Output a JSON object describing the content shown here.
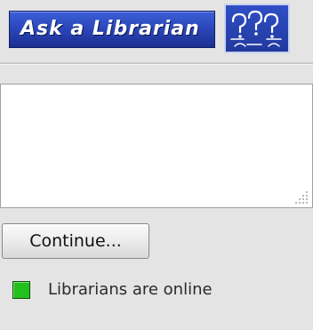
{
  "header": {
    "banner_text": "Ask a Librarian",
    "logo_icon": "question-marks-icon",
    "brand_color": "#2a45b8"
  },
  "question_box": {
    "value": "",
    "placeholder": ""
  },
  "continue_button": {
    "label": "Continue..."
  },
  "status": {
    "text": "Librarians are online",
    "indicator_color": "#22c01c"
  }
}
